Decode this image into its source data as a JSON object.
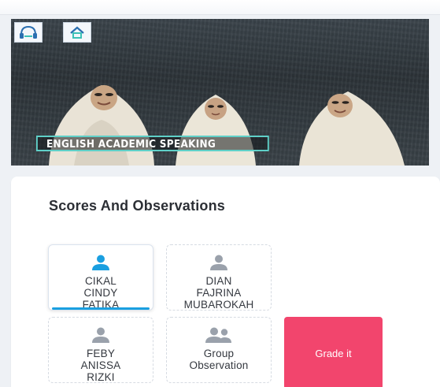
{
  "video": {
    "caption": "ENGLISH ACADEMIC SPEAKING",
    "logos": [
      "headphones-logo-icon",
      "house-logo-icon"
    ]
  },
  "scores": {
    "title": "Scores And Observations",
    "students": [
      {
        "name": "CIKAL\nCINDY\nFATIKA",
        "icon": "person-icon",
        "selected": true
      },
      {
        "name": "DIAN\nFAJRINA\nMUBAROKAH",
        "icon": "person-icon",
        "selected": false
      },
      {
        "name": "FEBY\nANISSA\nRIZKI",
        "icon": "person-icon",
        "selected": false
      },
      {
        "name": "Group\nObservation",
        "icon": "group-icon",
        "selected": false
      }
    ],
    "grade_label": "Grade it"
  },
  "colors": {
    "accent": "#1a9fe0",
    "grade_button": "#f2456d",
    "icon_inactive": "#9aa1ab"
  }
}
